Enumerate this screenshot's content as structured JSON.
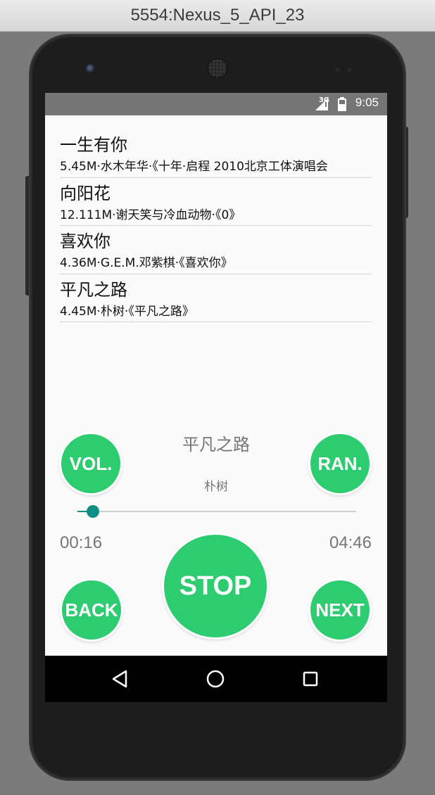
{
  "window": {
    "title": "5554:Nexus_5_API_23"
  },
  "status_bar": {
    "network": "3G",
    "time": "9:05"
  },
  "songs": [
    {
      "title": "一生有你",
      "meta": "5.45M·水木年华·《十年·启程 2010北京工体演唱会"
    },
    {
      "title": "向阳花",
      "meta": "12.111M·谢天笑与冷血动物·《0》"
    },
    {
      "title": "喜欢你",
      "meta": "4.36M·G.E.M.邓紫棋·《喜欢你》"
    },
    {
      "title": "平凡之路",
      "meta": "4.45M·朴树·《平凡之路》"
    }
  ],
  "player": {
    "now_title": "平凡之路",
    "now_artist": "朴树",
    "elapsed": "00:16",
    "total": "04:46",
    "progress_fraction": 0.056,
    "buttons": {
      "vol": "VOL.",
      "ran": "RAN.",
      "stop": "STOP",
      "back": "BACK",
      "next": "NEXT"
    }
  },
  "colors": {
    "accent_green": "#2ecc71",
    "seek_teal": "#0f8f84",
    "status_bar": "#757575"
  },
  "icons": {
    "nav_back": "back-triangle-icon",
    "nav_home": "home-circle-icon",
    "nav_recents": "recents-square-icon"
  }
}
